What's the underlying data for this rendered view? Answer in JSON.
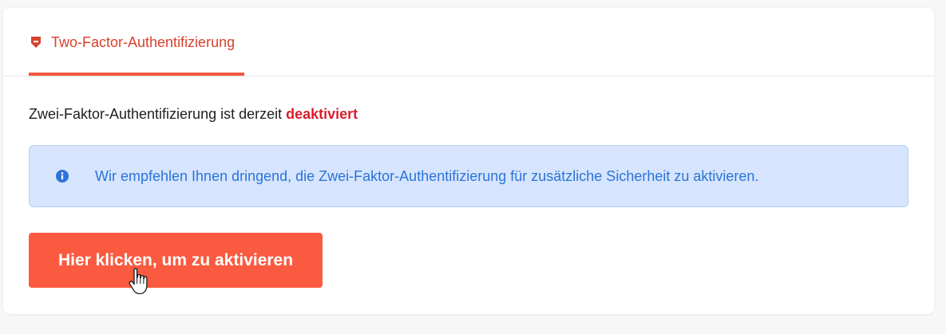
{
  "tabs": [
    {
      "label": "Two-Factor-Authentifizierung",
      "icon": "shield-icon",
      "active": true
    }
  ],
  "status": {
    "text": "Zwei-Faktor-Authentifizierung ist derzeit ",
    "value": "deaktiviert"
  },
  "info_alert": {
    "icon": "info-circle-icon",
    "text": "Wir empfehlen Ihnen dringend, die Zwei-Faktor-Authentifizierung für zusätzliche Sicherheit zu aktivieren."
  },
  "activate_button": {
    "label": "Hier klicken, um zu aktivieren"
  },
  "colors": {
    "accent": "#fa5a40",
    "tab_text": "#d9412e",
    "status_disabled": "#d81f2e",
    "info_background": "#d6e5fd",
    "info_text": "#2b73d9"
  }
}
